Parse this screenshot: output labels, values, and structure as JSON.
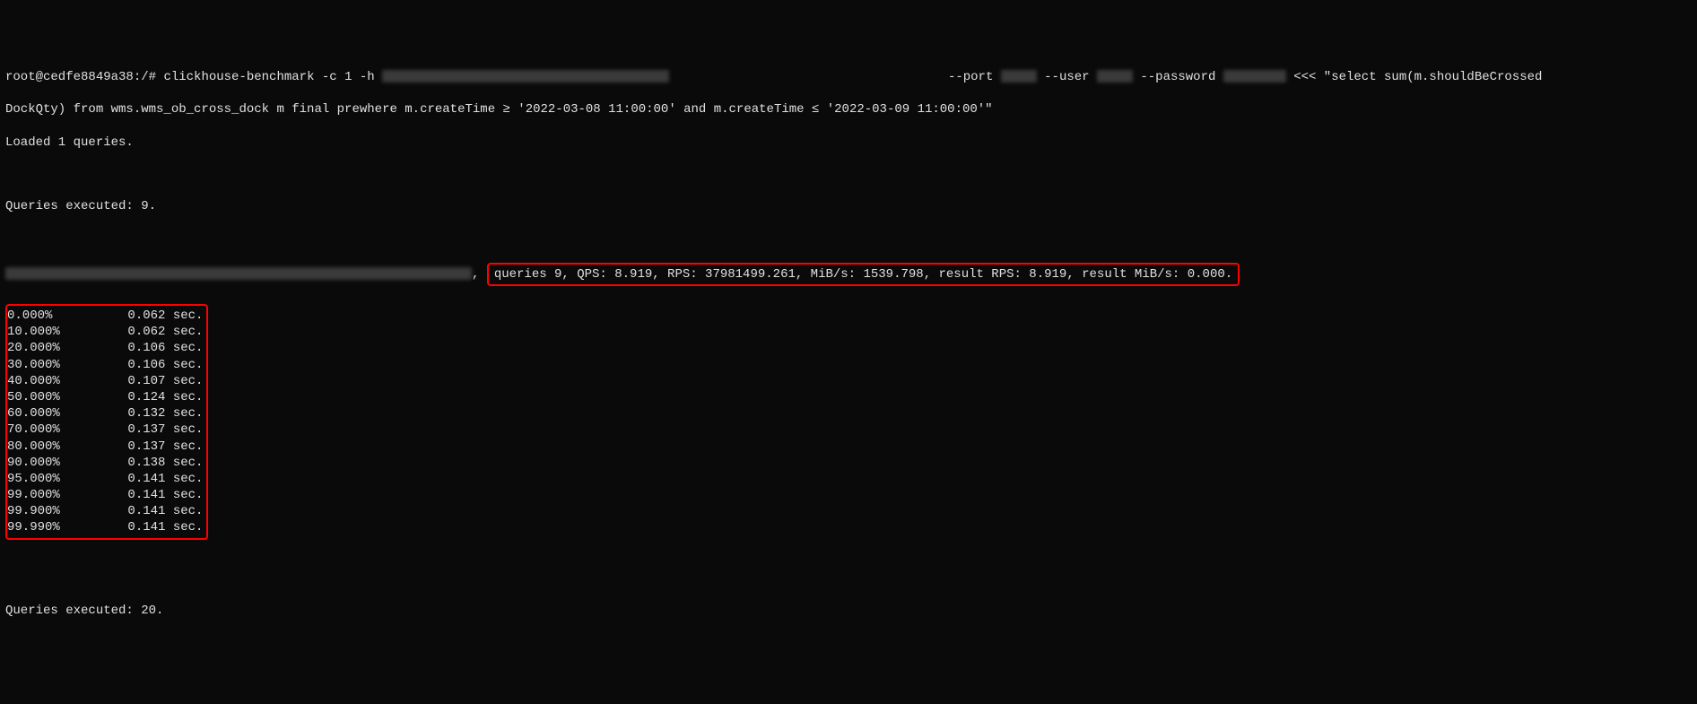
{
  "prompt": {
    "prefix": "root@cedfe8849a38:/# ",
    "cmd_part1": "clickhouse-benchmark -c 1 -h ",
    "cmd_part2": "--port ",
    "cmd_part3": " --user ",
    "cmd_part4": " --password ",
    "cmd_part5": " <<< \"select sum(m.shouldBeCrossed",
    "cmd_line2": "DockQty) from wms.wms_ob_cross_dock m final prewhere m.createTime ≥ '2022-03-08 11:00:00' and m.createTime ≤ '2022-03-09 11:00:00'\""
  },
  "loaded": "Loaded 1 queries.",
  "exec9": "Queries executed: 9.",
  "summary_sep": ", ",
  "summary": "queries 9, QPS: 8.919, RPS: 37981499.261, MiB/s: 1539.798, result RPS: 8.919, result MiB/s: 0.000.",
  "percentiles": [
    {
      "p": "0.000%",
      "v": "0.062 sec."
    },
    {
      "p": "10.000%",
      "v": "0.062 sec."
    },
    {
      "p": "20.000%",
      "v": "0.106 sec."
    },
    {
      "p": "30.000%",
      "v": "0.106 sec."
    },
    {
      "p": "40.000%",
      "v": "0.107 sec."
    },
    {
      "p": "50.000%",
      "v": "0.124 sec."
    },
    {
      "p": "60.000%",
      "v": "0.132 sec."
    },
    {
      "p": "70.000%",
      "v": "0.137 sec."
    },
    {
      "p": "80.000%",
      "v": "0.137 sec."
    },
    {
      "p": "90.000%",
      "v": "0.138 sec."
    },
    {
      "p": "95.000%",
      "v": "0.141 sec."
    },
    {
      "p": "99.000%",
      "v": "0.141 sec."
    },
    {
      "p": "99.900%",
      "v": "0.141 sec."
    },
    {
      "p": "99.990%",
      "v": "0.141 sec."
    }
  ],
  "exec20": "Queries executed: 20."
}
